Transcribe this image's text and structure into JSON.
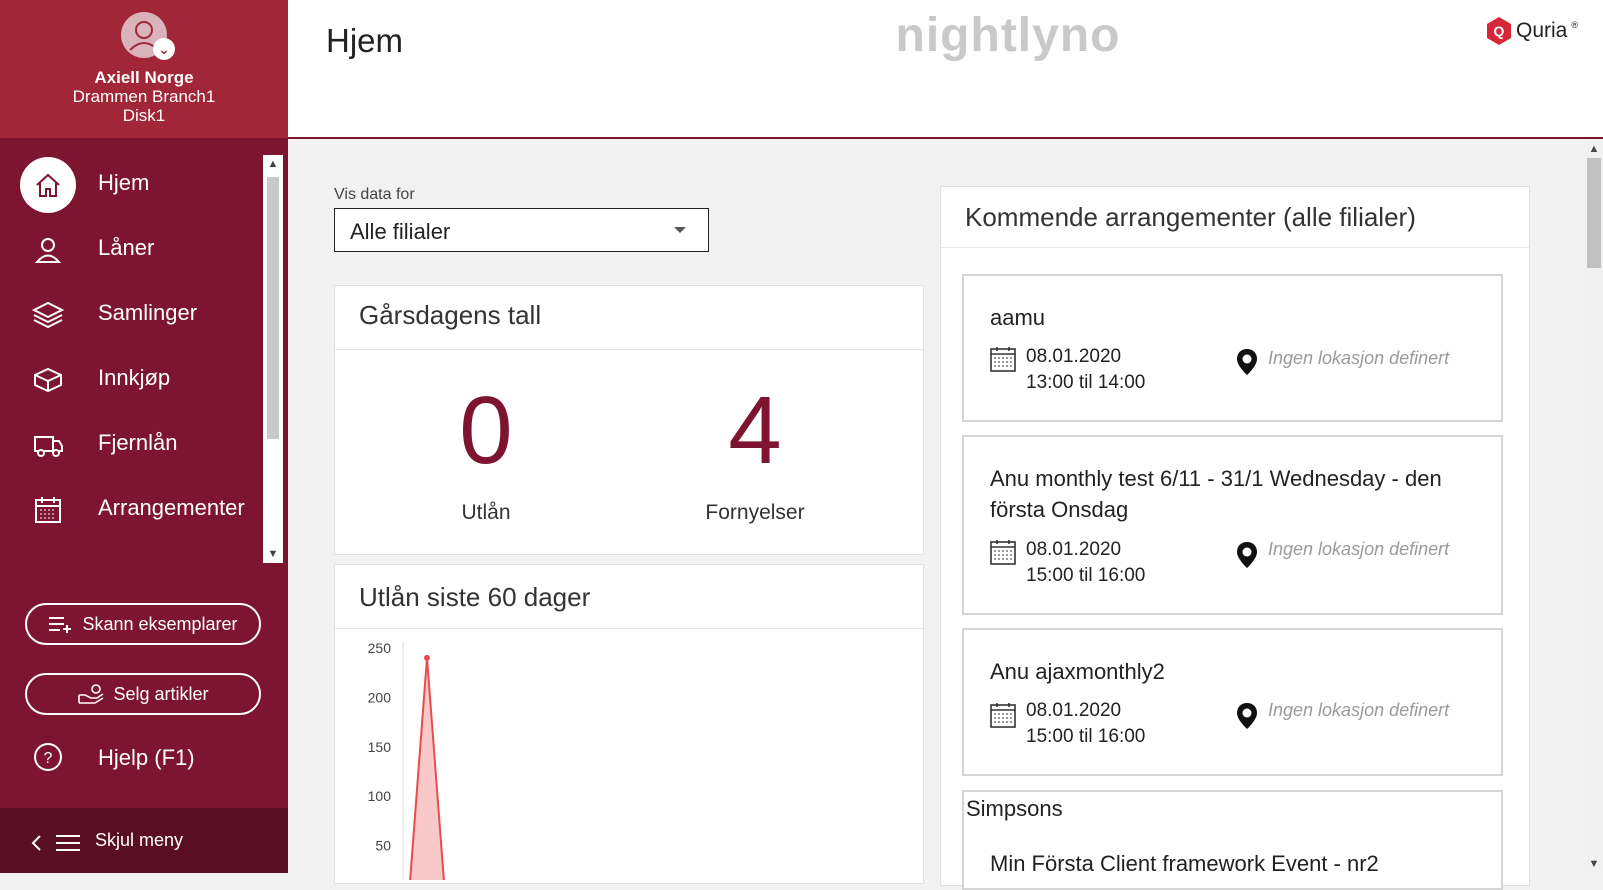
{
  "user": {
    "org": "Axiell Norge",
    "branch": "Drammen Branch1",
    "desk": "Disk1"
  },
  "nav": {
    "items": [
      {
        "label": "Hjem",
        "icon": "home-icon",
        "active": true
      },
      {
        "label": "Låner",
        "icon": "user-icon"
      },
      {
        "label": "Samlinger",
        "icon": "layers-icon"
      },
      {
        "label": "Innkjøp",
        "icon": "box-icon"
      },
      {
        "label": "Fjernlån",
        "icon": "truck-icon"
      },
      {
        "label": "Arrangementer",
        "icon": "calendar-icon"
      }
    ]
  },
  "actions": {
    "scan_label": "Skann eksemplarer",
    "sell_label": "Selg artikler"
  },
  "help": {
    "label": "Hjelp (F1)"
  },
  "hide_menu": {
    "label": "Skjul meny"
  },
  "header": {
    "title": "Hjem",
    "environment": "nightlyno",
    "brand": "Quria",
    "brand_mark": "®"
  },
  "filter": {
    "label": "Vis data for",
    "value": "Alle filialer"
  },
  "yesterday": {
    "title": "Gårsdagens tall",
    "stats": [
      {
        "value": "0",
        "label": "Utlån"
      },
      {
        "value": "4",
        "label": "Fornyelser"
      }
    ]
  },
  "loans_chart": {
    "title": "Utlån siste 60 dager"
  },
  "chart_data": {
    "type": "area",
    "title": "Utlån siste 60 dager",
    "y_ticks": [
      250,
      200,
      150,
      100,
      50
    ],
    "ylim": [
      0,
      250
    ],
    "x": [
      0,
      1,
      2
    ],
    "values": [
      0,
      240,
      0
    ],
    "color": "#e84c4c",
    "fill": "#f9c9c9"
  },
  "events": {
    "title": "Kommende arrangementer (alle filialer)",
    "items": [
      {
        "title": "aamu",
        "date": "08.01.2020",
        "time": "13:00 til 14:00",
        "location": "Ingen lokasjon definert"
      },
      {
        "title": "Anu monthly test 6/11 - 31/1 Wednesday - den första Onsdag",
        "date": "08.01.2020",
        "time": "15:00 til 16:00",
        "location": "Ingen lokasjon definert"
      },
      {
        "title": "Anu ajaxmonthly2",
        "date": "08.01.2020",
        "time": "15:00 til 16:00",
        "location": "Ingen lokasjon definert"
      }
    ],
    "group_title": "Simpsons",
    "group_first_event": "Min Första Client framework Event - nr2"
  },
  "colors": {
    "sidebar": "#7d1530",
    "profile": "#a02638",
    "accent": "#7d1530",
    "chart_line": "#e84c4c"
  }
}
